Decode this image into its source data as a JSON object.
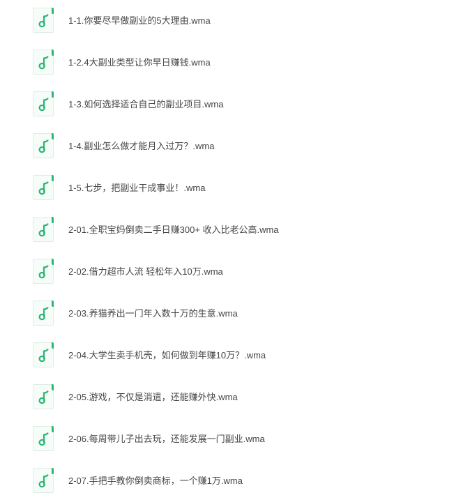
{
  "icon": {
    "name": "music-note-icon",
    "color": "#2bb673",
    "background": "#f6fcf8"
  },
  "files": [
    {
      "name": "1-1.你要尽早做副业的5大理由.wma"
    },
    {
      "name": "1-2.4大副业类型让你早日赚钱.wma"
    },
    {
      "name": "1-3.如何选择适合自己的副业项目.wma"
    },
    {
      "name": "1-4.副业怎么做才能月入过万？.wma"
    },
    {
      "name": "1-5.七步，把副业干成事业！.wma"
    },
    {
      "name": "2-01.全职宝妈倒卖二手日赚300+ 收入比老公高.wma"
    },
    {
      "name": "2-02.借力超市人流 轻松年入10万.wma"
    },
    {
      "name": "2-03.养猫养出一门年入数十万的生意.wma"
    },
    {
      "name": "2-04.大学生卖手机壳，如何做到年赚10万？.wma"
    },
    {
      "name": "2-05.游戏，不仅是消遣，还能赚外快.wma"
    },
    {
      "name": "2-06.每周带儿子出去玩，还能发展一门副业.wma"
    },
    {
      "name": "2-07.手把手教你倒卖商标，一个赚1万.wma"
    }
  ]
}
